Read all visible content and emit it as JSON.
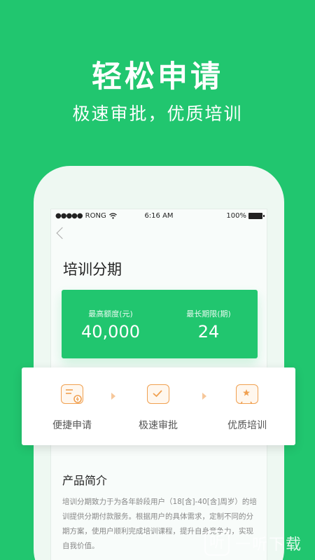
{
  "hero": {
    "title": "轻松申请",
    "subtitle": "极速审批，优质培训"
  },
  "status_bar": {
    "signal_dots": "●●●●●",
    "carrier": "RONG",
    "time": "6:16 AM",
    "battery": "100%"
  },
  "page": {
    "title": "培训分期"
  },
  "quota_card": {
    "max_amount_label": "最高额度(元)",
    "max_amount_value": "40,000",
    "max_term_label": "最长期限(期)",
    "max_term_value": "24"
  },
  "steps": [
    {
      "label": "便捷申请",
      "icon": "application-form-icon"
    },
    {
      "label": "极速审批",
      "icon": "approval-check-icon"
    },
    {
      "label": "优质培训",
      "icon": "training-screen-icon"
    }
  ],
  "intro": {
    "title": "产品简介",
    "text": "培训分期致力于为各年龄段用户（18[含]-40[含]周岁）的培训提供分期付款服务。根据用户的具体需求，定制不同的分期方案，使用户顺利完成培训课程，提升自身竞争力，实现自我价值。"
  },
  "watermark": {
    "mark": "听",
    "text": "一听下载"
  },
  "colors": {
    "brand_green": "#21c66f",
    "step_orange": "#f0a050"
  }
}
